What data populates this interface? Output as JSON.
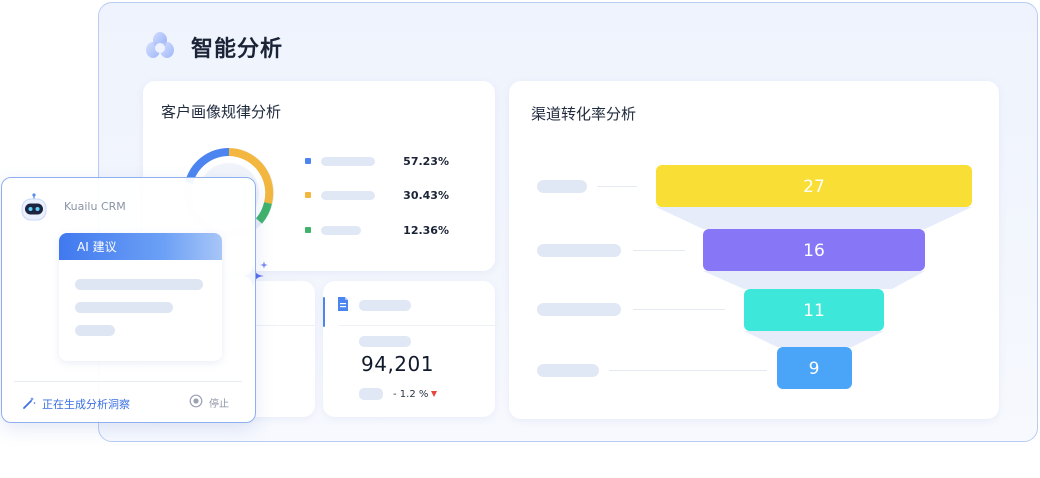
{
  "header": {
    "title": "智能分析"
  },
  "portrait_card": {
    "title": "客户画像规律分析",
    "legend": [
      {
        "color": "#4d85f0",
        "value": "57.23%"
      },
      {
        "color": "#f3b73f",
        "value": "30.43%"
      },
      {
        "color": "#3fb36b",
        "value": "12.36%"
      }
    ]
  },
  "metric_card": {
    "value": "94,201",
    "change": "- 1.2 %",
    "trend_icon": "triangle-down-icon",
    "trend_color": "#e8453c"
  },
  "funnel_card": {
    "title": "渠道转化率分析",
    "stages": [
      {
        "value": "27",
        "color": "#f9df35"
      },
      {
        "value": "16",
        "color": "#8777f7"
      },
      {
        "value": "11",
        "color": "#3de8da"
      },
      {
        "value": "9",
        "color": "#4aa5f8"
      }
    ]
  },
  "ai_panel": {
    "brand": "Kuailu CRM",
    "suggestion_title": "AI 建议",
    "status_text": "正在生成分析洞察",
    "stop_label": "停止"
  }
}
